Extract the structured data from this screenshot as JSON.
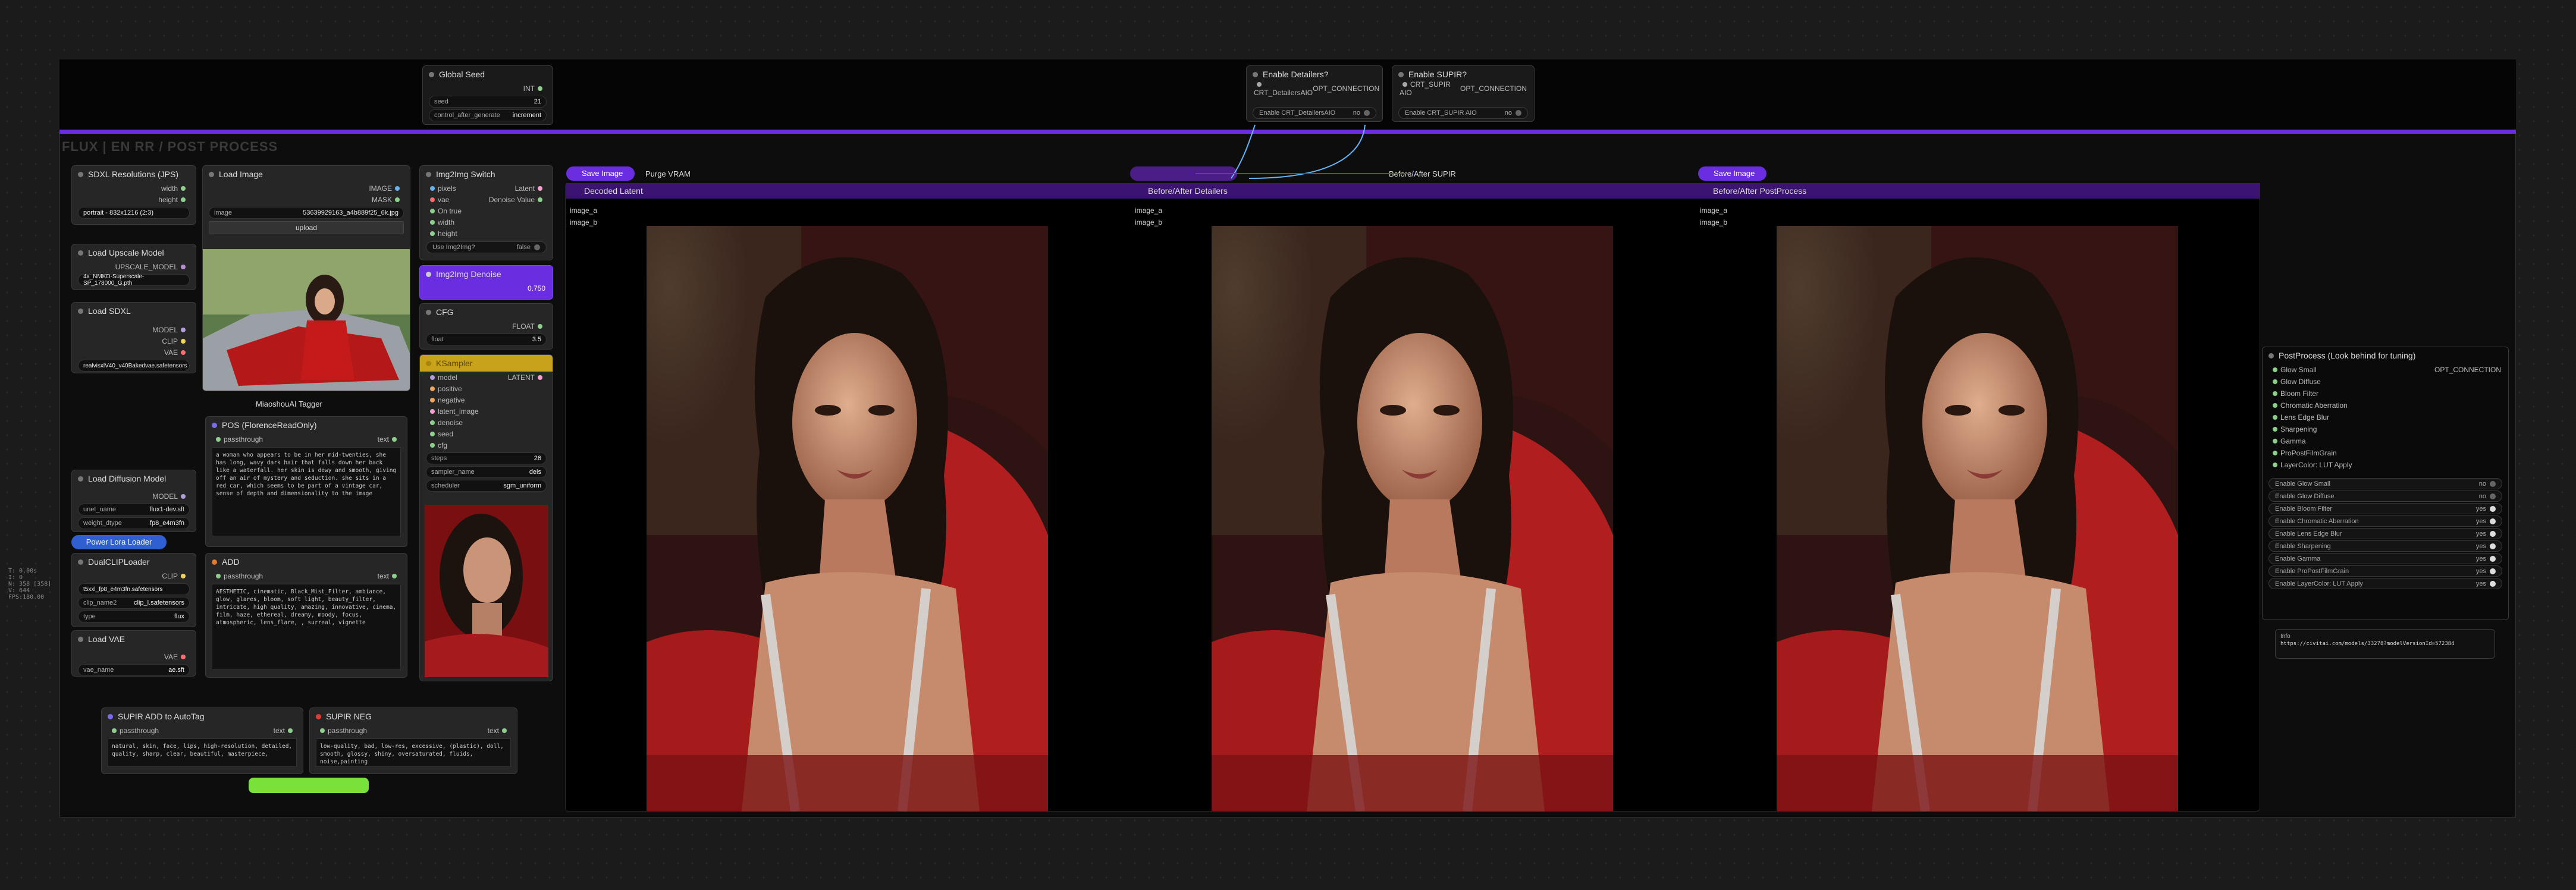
{
  "group": {
    "title": "FLUX | EN RR / POST PROCESS"
  },
  "global_seed": {
    "title": "Global Seed",
    "out": "INT",
    "seed_label": "seed",
    "seed": "21",
    "cag_label": "control_after_generate",
    "cag": "increment"
  },
  "detailers": {
    "title": "Enable Detailers?",
    "out1": "CRT_DetailersAIO",
    "out2": "OPT_CONNECTION",
    "toggle": "Enable CRT_DetailersAIO",
    "toggle_val": "no"
  },
  "supir": {
    "title": "Enable SUPIR?",
    "out1": "CRT_SUPIR AIO",
    "out2": "OPT_CONNECTION",
    "toggle": "Enable CRT_SUPIR AIO",
    "toggle_val": "no"
  },
  "sdxl_res": {
    "title": "SDXL Resolutions (JPS)",
    "o1": "width",
    "o2": "height",
    "val": "portrait - 832x1216 (2:3)"
  },
  "upscale": {
    "title": "Load Upscale Model",
    "out": "UPSCALE_MODEL",
    "val": "4x_NMKD-Superscale-SP_178000_G.pth"
  },
  "load_sdxl": {
    "title": "Load SDXL",
    "o1": "MODEL",
    "o2": "CLIP",
    "o3": "VAE",
    "val": "realvisxlV40_v40Bakedvae.safetensors"
  },
  "load_diff": {
    "title": "Load Diffusion Model",
    "out": "MODEL",
    "l1": "unet_name",
    "v1": "flux1-dev.sft",
    "l2": "weight_dtype",
    "v2": "fp8_e4m3fn"
  },
  "lora": {
    "title": "Power Lora Loader"
  },
  "dualclip": {
    "title": "DualCLIPLoader",
    "out": "CLIP",
    "v1": "t5xxl_fp8_e4m3fn.safetensors",
    "l2": "clip_name2",
    "v2": "clip_l.safetensors",
    "l3": "type",
    "v3": "flux"
  },
  "vae": {
    "title": "Load VAE",
    "out": "VAE",
    "l": "vae_name",
    "v": "ae.sft"
  },
  "load_image": {
    "title": "Load Image",
    "o1": "IMAGE",
    "o2": "MASK",
    "l": "image",
    "v": "53639929163_a4b889f25_6k.jpg",
    "upload": "upload"
  },
  "tagger": {
    "title": "MiaoshouAI Tagger"
  },
  "pos": {
    "title": "POS (FlorenceReadOnly)",
    "in": "passthrough",
    "out": "text",
    "text": "a woman who appears to be in her mid-twenties, she has long, wavy dark hair that falls down her back like a waterfall. her skin is dewy and smooth, giving off an air of mystery and seduction. she sits in a red car, which seems to be part of a vintage car, sense of depth and dimensionality to the image"
  },
  "add": {
    "title": "ADD",
    "in": "passthrough",
    "out": "text",
    "text": "AESTHETIC, cinematic, Black_Mist_Filter, ambiance, glow, glares, bloom, soft light, beauty_filter, intricate, high quality, amazing, innovative, cinema, film, haze, ethereal, dreamy, moody, focus, atmospheric, lens_flare, , surreal, vignette"
  },
  "i2i_switch": {
    "title": "Img2Img Switch",
    "i1": "pixels",
    "i2": "vae",
    "i3": "On true",
    "i4": "width",
    "i5": "height",
    "o1": "Latent",
    "o2": "Denoise Value",
    "tog": "Use Img2Img?",
    "tog_val": "false"
  },
  "i2i_denoise": {
    "title": "Img2Img Denoise",
    "val": "0.750"
  },
  "cfg": {
    "title": "CFG",
    "out": "FLOAT",
    "l": "float",
    "v": "3.5"
  },
  "ksampler": {
    "title": "KSampler",
    "i1": "model",
    "i2": "positive",
    "i3": "negative",
    "i4": "latent_image",
    "i5": "denoise",
    "i6": "seed",
    "i7": "cfg",
    "out": "LATENT",
    "l1": "steps",
    "v1": "26",
    "l2": "sampler_name",
    "v2": "deis",
    "l3": "scheduler",
    "v3": "sgm_uniform"
  },
  "supir_add": {
    "title": "SUPIR ADD to AutoTag",
    "in": "passthrough",
    "out": "text",
    "text": "natural, skin, face, lips, high-resolution, detailed, quality, sharp, clear, beautiful, masterpiece,"
  },
  "supir_neg": {
    "title": "SUPIR NEG",
    "in": "passthrough",
    "out": "text",
    "text": "low-quality, bad, low-res, excessive, (plastic), doll, smooth, glossy, shiny, oversaturated, fluids, noise,painting"
  },
  "save1": {
    "title": "Save Image"
  },
  "purge": {
    "title": "Purge VRAM"
  },
  "ba_supir": {
    "title": "Before/After SUPIR"
  },
  "save2": {
    "title": "Save Image"
  },
  "decoded": {
    "title": "Decoded Latent",
    "ia": "image_a",
    "ib": "image_b"
  },
  "ba_det": {
    "title": "Before/After Detailers",
    "ia": "image_a",
    "ib": "image_b"
  },
  "ba_pp": {
    "title": "Before/After PostProcess",
    "ia": "image_a",
    "ib": "image_b"
  },
  "postproc": {
    "title": "PostProcess (Look behind for tuning)",
    "out": "OPT_CONNECTION",
    "inputs": [
      "Glow Small",
      "Glow Diffuse",
      "Bloom Filter",
      "Chromatic Aberration",
      "Lens Edge Blur",
      "Sharpening",
      "Gamma",
      "ProPostFilmGrain",
      "LayerColor: LUT Apply"
    ],
    "toggles": [
      {
        "l": "Enable Glow Small",
        "v": "no"
      },
      {
        "l": "Enable Glow Diffuse",
        "v": "no"
      },
      {
        "l": "Enable Bloom Filter",
        "v": "yes"
      },
      {
        "l": "Enable Chromatic Aberration",
        "v": "yes"
      },
      {
        "l": "Enable Lens Edge Blur",
        "v": "yes"
      },
      {
        "l": "Enable Sharpening",
        "v": "yes"
      },
      {
        "l": "Enable Gamma",
        "v": "yes"
      },
      {
        "l": "Enable ProPostFilmGrain",
        "v": "yes"
      },
      {
        "l": "Enable LayerColor: LUT Apply",
        "v": "yes"
      }
    ],
    "info_label": "Info",
    "info_url": "https://civitai.com/models/33278?modelVersionId=572384"
  },
  "stats": {
    "l1": "T: 0.00s",
    "l2": "I: 0",
    "l3": "N: 358 [358]",
    "l4": "V: 644",
    "l5": "FPS:180.00"
  },
  "colors": {
    "purple": "#6a2ee0",
    "ksampler": "#c9a21b",
    "lora": "#2f5fd0",
    "green": "#7ae13a"
  }
}
